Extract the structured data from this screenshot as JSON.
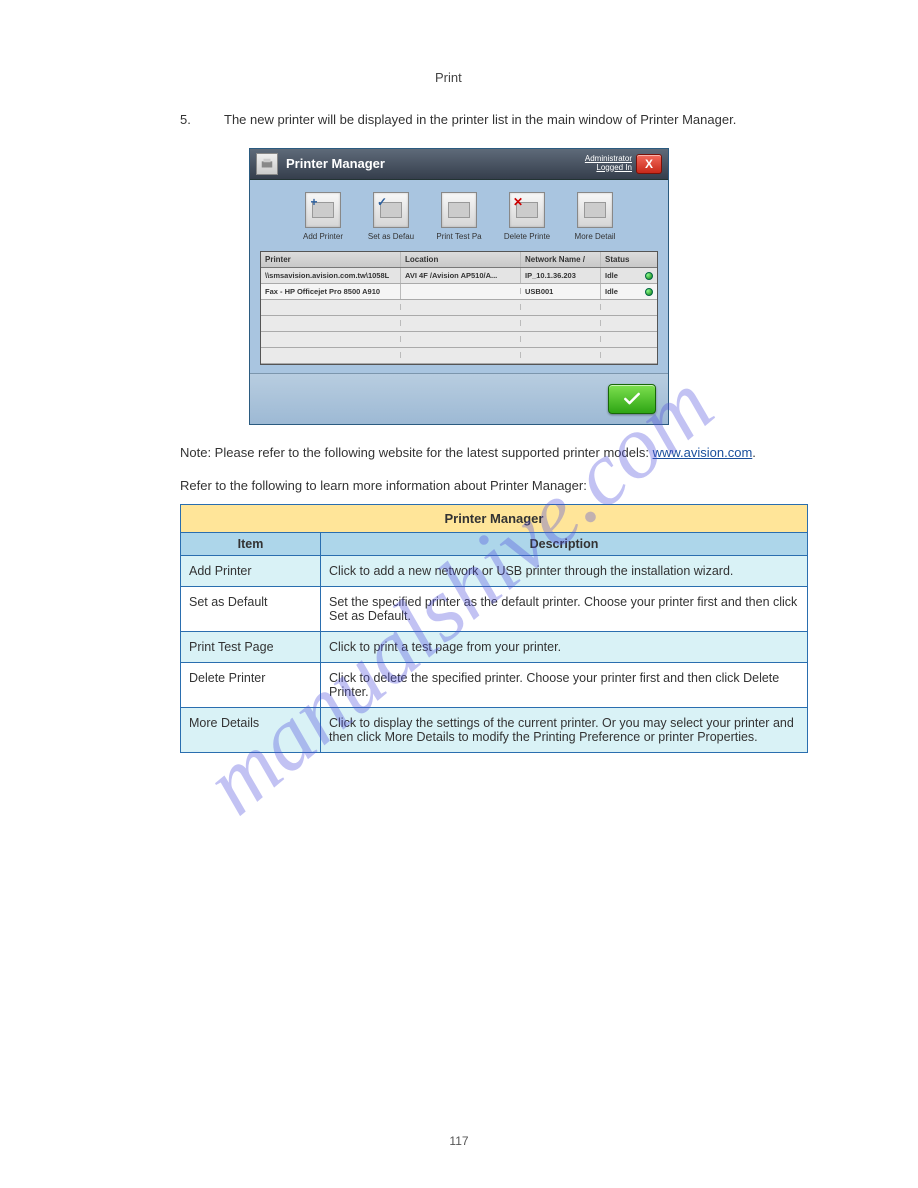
{
  "watermark": "manualshive.com",
  "header_note": "Print",
  "step": {
    "num": "5.",
    "text_a": "The new printer will be displayed in the printer list in the main window of ",
    "text_b": "Printer Manager",
    "text_c": "."
  },
  "dialog": {
    "title": "Printer Manager",
    "admin": "Administrator",
    "logged": "Logged In",
    "close": "X",
    "tools": {
      "add": "Add Printer",
      "default": "Set as Defau",
      "test": "Print Test Pa",
      "delete": "Delete Printe",
      "more": "More Detail"
    },
    "columns": {
      "printer": "Printer",
      "location": "Location",
      "network": "Network Name /",
      "status": "Status"
    },
    "rows": [
      {
        "printer": "\\\\smsavision.avision.com.tw\\1058L",
        "location": "AVI 4F /Avision AP510/A...",
        "network": "IP_10.1.36.203",
        "status": "Idle"
      },
      {
        "printer": "Fax - HP Officejet Pro 8500 A910",
        "location": "",
        "network": "USB001",
        "status": "Idle"
      }
    ]
  },
  "note_line1": "Note: Please refer to the following website for the latest supported printer models: ",
  "note_link": "www.avision.com",
  "note_line2": ".    ",
  "note_line3": "Refer to the following to learn more information about Printer Manager:",
  "table": {
    "title": "Printer Manager",
    "col1": "Item",
    "col2": "Description",
    "rows": [
      {
        "item": "Add Printer",
        "desc": "Click to add a new network or USB printer through the installation wizard."
      },
      {
        "item": "Set as Default",
        "desc": "Set the specified printer as the default printer. Choose your printer first and then click Set as Default."
      },
      {
        "item": "Print Test Page",
        "desc": "Click to print a test page from your printer."
      },
      {
        "item": "Delete Printer",
        "desc": "Click to delete the specified printer. Choose your printer first and then click Delete Printer."
      },
      {
        "item": "More Details",
        "desc": "Click to display the settings of the current printer. Or you may select your printer and then click More Details to modify the Printing Preference or printer Properties."
      }
    ]
  },
  "footer_page": "117"
}
